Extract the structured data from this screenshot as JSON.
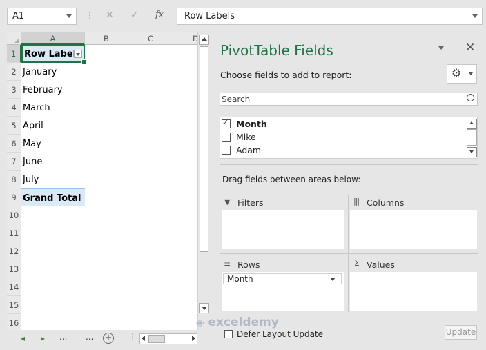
{
  "formula_bar": {
    "name_box": "A1",
    "cancel_icon": "✕",
    "enter_icon": "✓",
    "fx_label": "fx",
    "formula_value": "Row Labels"
  },
  "grid": {
    "columns": [
      "A",
      "B",
      "C",
      "D"
    ],
    "row_numbers": [
      "1",
      "2",
      "3",
      "4",
      "5",
      "6",
      "7",
      "8",
      "9",
      "10",
      "11",
      "12",
      "13",
      "14",
      "15",
      "16"
    ],
    "cells": [
      "Row Labels",
      "January",
      "February",
      "March",
      "April",
      "May",
      "June",
      "July",
      "Grand Total"
    ]
  },
  "sheet_bar": {
    "ellipsis_left": "...",
    "ellipsis_right": "...",
    "add_sheet": "+"
  },
  "pivot_pane": {
    "title": "PivotTable Fields",
    "subtitle": "Choose fields to add to report:",
    "search_placeholder": "Search",
    "fields": [
      {
        "label": "Month",
        "checked": true
      },
      {
        "label": "Mike",
        "checked": false
      },
      {
        "label": "Adam",
        "checked": false
      }
    ],
    "drag_hint": "Drag fields between areas below:",
    "areas": {
      "filters": "Filters",
      "columns": "Columns",
      "rows": "Rows",
      "values": "Values"
    },
    "rows_item": "Month",
    "defer_label": "Defer Layout Update",
    "update_button": "Update",
    "watermark": "exceldemy"
  },
  "colors": {
    "accent_green": "#217346",
    "selection_fill": "#dbe9f7"
  }
}
